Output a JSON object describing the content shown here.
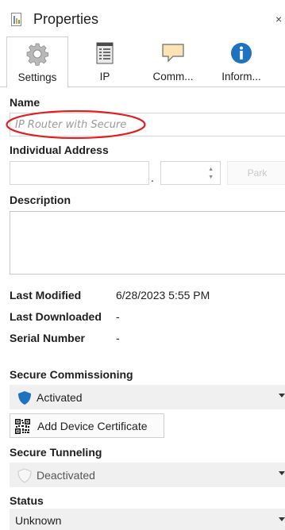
{
  "panel": {
    "title": "Properties",
    "close_glyph": "×"
  },
  "tabs": [
    {
      "label": "Settings",
      "icon": "gear-icon"
    },
    {
      "label": "IP",
      "icon": "list-document-icon"
    },
    {
      "label": "Comm...",
      "icon": "speech-bubble-icon"
    },
    {
      "label": "Inform...",
      "icon": "info-icon"
    }
  ],
  "name": {
    "label": "Name",
    "placeholder": "IP Router with Secure",
    "value": ""
  },
  "individual_address": {
    "label": "Individual Address",
    "separator": ".",
    "park_label": "Park"
  },
  "description": {
    "label": "Description",
    "value": ""
  },
  "info": {
    "last_modified_label": "Last Modified",
    "last_modified_value": "6/28/2023 5:55 PM",
    "last_downloaded_label": "Last Downloaded",
    "last_downloaded_value": "-",
    "serial_number_label": "Serial Number",
    "serial_number_value": "-"
  },
  "secure_commissioning": {
    "label": "Secure Commissioning",
    "selected": "Activated",
    "icon": "shield-icon"
  },
  "certificate_button": {
    "label": "Add Device Certificate",
    "icon": "qr-code-icon"
  },
  "secure_tunneling": {
    "label": "Secure Tunneling",
    "selected": "Deactivated",
    "icon": "shield-outline-icon"
  },
  "status": {
    "label": "Status",
    "selected": "Unknown"
  },
  "colors": {
    "accent": "#1e73c0",
    "annotation": "#e02020",
    "field_bg": "#f0f0f0"
  }
}
